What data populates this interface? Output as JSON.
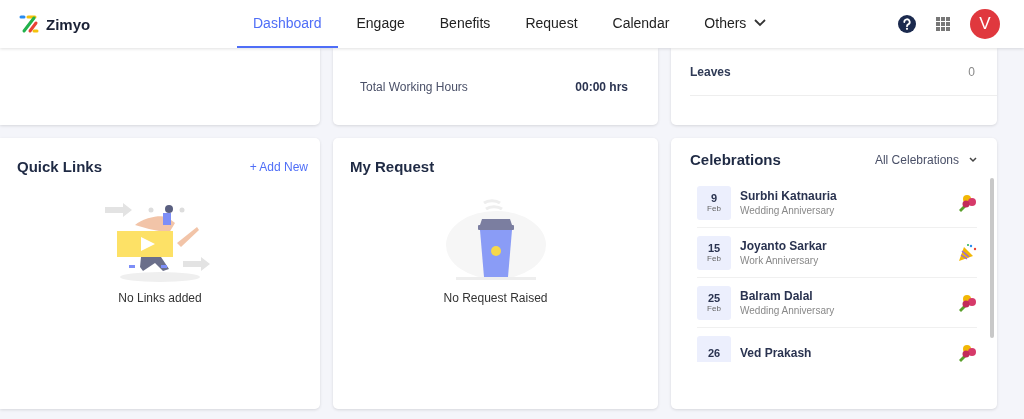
{
  "brand": {
    "name": "Zimyo"
  },
  "nav": [
    {
      "label": "Dashboard",
      "selected": true,
      "dropdown": false
    },
    {
      "label": "Engage",
      "selected": false,
      "dropdown": false
    },
    {
      "label": "Benefits",
      "selected": false,
      "dropdown": false
    },
    {
      "label": "Request",
      "selected": false,
      "dropdown": false
    },
    {
      "label": "Calendar",
      "selected": false,
      "dropdown": false
    },
    {
      "label": "Others",
      "selected": false,
      "dropdown": true
    }
  ],
  "user": {
    "initial": "V"
  },
  "working_hours": {
    "label": "Total Working Hours",
    "value": "00:00 hrs"
  },
  "leaves": {
    "label": "Leaves",
    "value": "0"
  },
  "quick_links": {
    "title": "Quick Links",
    "action": "+ Add New",
    "empty": "No Links added"
  },
  "my_request": {
    "title": "My Request",
    "empty": "No Request Raised"
  },
  "celebrations": {
    "title": "Celebrations",
    "filter": "All Celebrations",
    "items": [
      {
        "day": "9",
        "month": "Feb",
        "name": "Surbhi Katnauria",
        "type": "Wedding Anniversary",
        "kind": "bouquet"
      },
      {
        "day": "15",
        "month": "Feb",
        "name": "Joyanto Sarkar",
        "type": "Work Anniversary",
        "kind": "party"
      },
      {
        "day": "25",
        "month": "Feb",
        "name": "Balram Dalal",
        "type": "Wedding Anniversary",
        "kind": "bouquet"
      },
      {
        "day": "26",
        "name": "Ved Prakash",
        "kind": "bouquet"
      }
    ]
  }
}
